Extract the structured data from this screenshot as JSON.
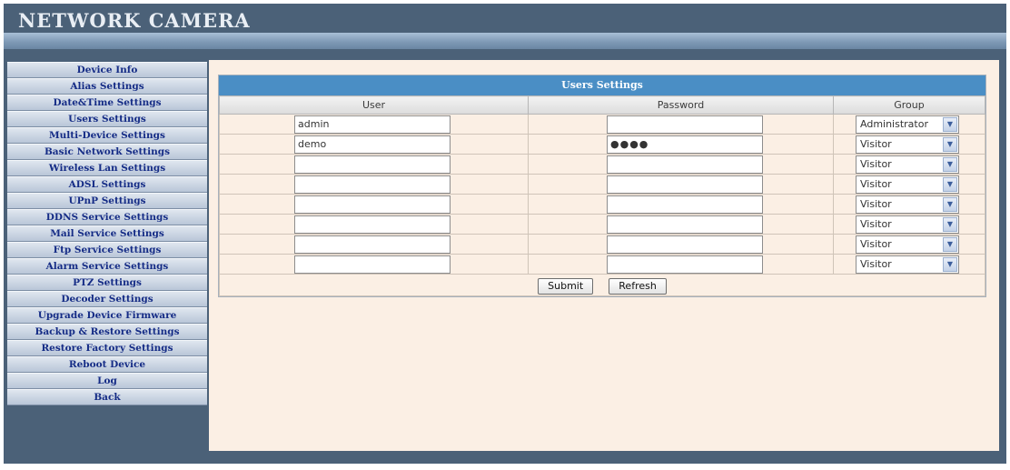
{
  "app": {
    "title": "NETWORK CAMERA"
  },
  "sidebar": {
    "items": [
      "Device Info",
      "Alias Settings",
      "Date&Time Settings",
      "Users Settings",
      "Multi-Device Settings",
      "Basic Network Settings",
      "Wireless Lan Settings",
      "ADSL Settings",
      "UPnP Settings",
      "DDNS Service Settings",
      "Mail Service Settings",
      "Ftp Service Settings",
      "Alarm Service Settings",
      "PTZ Settings",
      "Decoder Settings",
      "Upgrade Device Firmware",
      "Backup & Restore Settings",
      "Restore Factory Settings",
      "Reboot Device",
      "Log",
      "Back"
    ]
  },
  "users_panel": {
    "title": "Users Settings",
    "headers": {
      "user": "User",
      "password": "Password",
      "group": "Group"
    },
    "rows": [
      {
        "user": "admin",
        "password": "",
        "group": "Administrator"
      },
      {
        "user": "demo",
        "password": "●●●●",
        "group": "Visitor"
      },
      {
        "user": "",
        "password": "",
        "group": "Visitor"
      },
      {
        "user": "",
        "password": "",
        "group": "Visitor"
      },
      {
        "user": "",
        "password": "",
        "group": "Visitor"
      },
      {
        "user": "",
        "password": "",
        "group": "Visitor"
      },
      {
        "user": "",
        "password": "",
        "group": "Visitor"
      },
      {
        "user": "",
        "password": "",
        "group": "Visitor"
      }
    ],
    "submit_label": "Submit",
    "refresh_label": "Refresh"
  },
  "icons": {
    "dropdown": "chevron-down-icon"
  },
  "colors": {
    "frame": "#4b6178",
    "panel_title": "#4a8ec5",
    "content_bg": "#fbefe4",
    "sidebar_text": "#152c86"
  }
}
